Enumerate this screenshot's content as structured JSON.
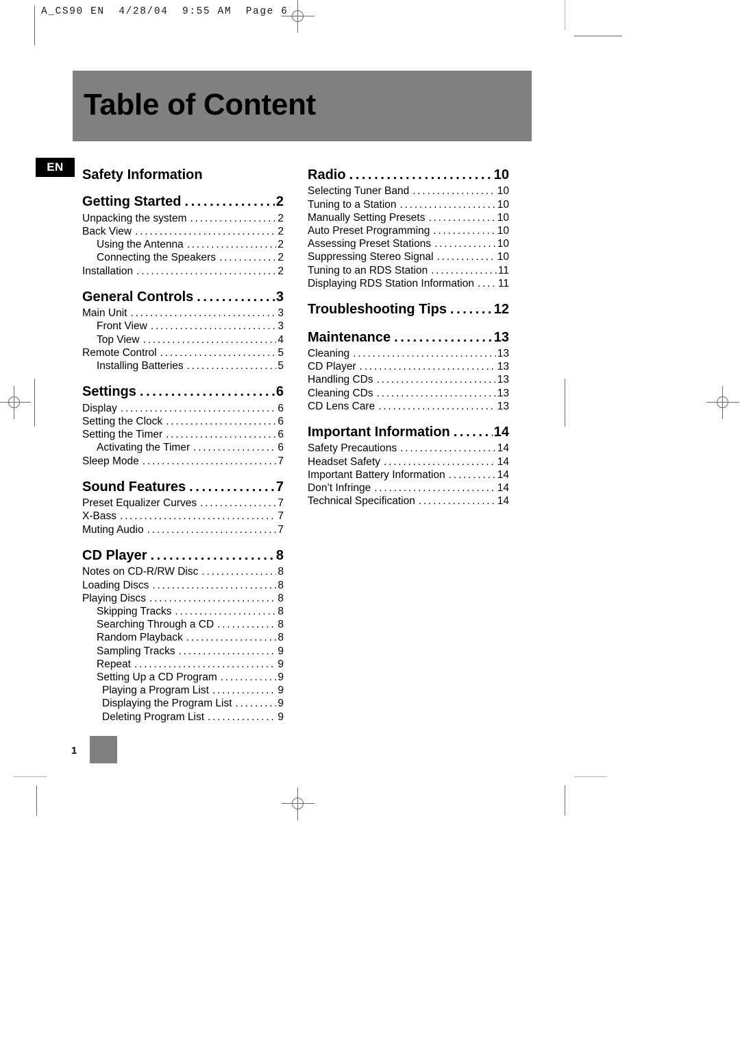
{
  "film_header": "A_CS90 EN  4/28/04  9:55 AM  Page 6",
  "banner": {
    "title": "Table of Content",
    "bg_color": "#808080"
  },
  "language_badge": {
    "label": "EN",
    "bg_color": "#000000",
    "text_color": "#ffffff"
  },
  "footer": {
    "page_number": "1",
    "swatch_color": "#808080"
  },
  "toc": {
    "left_column": [
      {
        "label": "Safety Information",
        "page": "",
        "level": "h",
        "dots": false,
        "gap": false
      },
      {
        "label": "Getting Started",
        "page": "2",
        "level": "h",
        "dots": true,
        "gap": false
      },
      {
        "label": "Unpacking the system",
        "page": "2",
        "level": "1",
        "dots": true,
        "gap": false
      },
      {
        "label": "Back View",
        "page": "2",
        "level": "1",
        "dots": true,
        "gap": false
      },
      {
        "label": "Using the Antenna",
        "page": "2",
        "level": "2",
        "dots": true,
        "gap": false
      },
      {
        "label": "Connecting the Speakers",
        "page": "2",
        "level": "2",
        "dots": true,
        "gap": false
      },
      {
        "label": "Installation",
        "page": "2",
        "level": "1",
        "dots": true,
        "gap": false
      },
      {
        "label": "General Controls",
        "page": "3",
        "level": "h",
        "dots": true,
        "gap": true
      },
      {
        "label": "Main Unit",
        "page": "3",
        "level": "1",
        "dots": true,
        "gap": false
      },
      {
        "label": "Front View",
        "page": "3",
        "level": "2",
        "dots": true,
        "gap": false
      },
      {
        "label": "Top View",
        "page": "4",
        "level": "2",
        "dots": true,
        "gap": false
      },
      {
        "label": "Remote Control",
        "page": "5",
        "level": "1",
        "dots": true,
        "gap": false
      },
      {
        "label": "Installing Batteries",
        "page": "5",
        "level": "2",
        "dots": true,
        "gap": false
      },
      {
        "label": "Settings",
        "page": "6",
        "level": "h",
        "dots": true,
        "gap": true
      },
      {
        "label": "Display",
        "page": "6",
        "level": "1",
        "dots": true,
        "gap": false
      },
      {
        "label": "Setting the Clock",
        "page": "6",
        "level": "1",
        "dots": true,
        "gap": false
      },
      {
        "label": "Setting the Timer",
        "page": "6",
        "level": "1",
        "dots": true,
        "gap": false
      },
      {
        "label": "Activating the Timer",
        "page": "6",
        "level": "2",
        "dots": true,
        "gap": false
      },
      {
        "label": "Sleep Mode",
        "page": "7",
        "level": "1",
        "dots": true,
        "gap": false
      },
      {
        "label": "Sound Features",
        "page": "7",
        "level": "h",
        "dots": true,
        "gap": true
      },
      {
        "label": "Preset Equalizer Curves",
        "page": "7",
        "level": "1",
        "dots": true,
        "gap": false
      },
      {
        "label": "X-Bass",
        "page": "7",
        "level": "1",
        "dots": true,
        "gap": false
      },
      {
        "label": "Muting Audio",
        "page": "7",
        "level": "1",
        "dots": true,
        "gap": false
      },
      {
        "label": "CD Player",
        "page": "8",
        "level": "h",
        "dots": true,
        "gap": true
      },
      {
        "label": "Notes on CD-R/RW Disc",
        "page": "8",
        "level": "1",
        "dots": true,
        "gap": false
      },
      {
        "label": "Loading Discs",
        "page": "8",
        "level": "1",
        "dots": true,
        "gap": false
      },
      {
        "label": "Playing Discs",
        "page": "8",
        "level": "1",
        "dots": true,
        "gap": false
      },
      {
        "label": "Skipping Tracks",
        "page": "8",
        "level": "2",
        "dots": true,
        "gap": false
      },
      {
        "label": "Searching Through a CD",
        "page": "8",
        "level": "2",
        "dots": true,
        "gap": false
      },
      {
        "label": "Random Playback",
        "page": "8",
        "level": "2",
        "dots": true,
        "gap": false
      },
      {
        "label": "Sampling Tracks",
        "page": "9",
        "level": "2",
        "dots": true,
        "gap": false
      },
      {
        "label": "Repeat",
        "page": "9",
        "level": "2",
        "dots": true,
        "gap": false
      },
      {
        "label": "Setting Up a CD Program",
        "page": "9",
        "level": "2",
        "dots": true,
        "gap": false
      },
      {
        "label": "Playing a Program List",
        "page": "9",
        "level": "3",
        "dots": true,
        "gap": false
      },
      {
        "label": "Displaying the Program List",
        "page": "9",
        "level": "3",
        "dots": true,
        "gap": false
      },
      {
        "label": "Deleting Program List",
        "page": "9",
        "level": "3",
        "dots": true,
        "gap": false
      }
    ],
    "right_column": [
      {
        "label": "Radio",
        "page": "10",
        "level": "h",
        "dots": true,
        "gap": false
      },
      {
        "label": "Selecting Tuner Band",
        "page": "10",
        "level": "1",
        "dots": true,
        "gap": false
      },
      {
        "label": "Tuning to a Station",
        "page": "10",
        "level": "1",
        "dots": true,
        "gap": false
      },
      {
        "label": "Manually Setting Presets",
        "page": "10",
        "level": "1",
        "dots": true,
        "gap": false
      },
      {
        "label": "Auto Preset Programming",
        "page": "10",
        "level": "1",
        "dots": true,
        "gap": false
      },
      {
        "label": "Assessing Preset Stations",
        "page": "10",
        "level": "1",
        "dots": true,
        "gap": false
      },
      {
        "label": "Suppressing Stereo Signal",
        "page": "10",
        "level": "1",
        "dots": true,
        "gap": false
      },
      {
        "label": "Tuning to an RDS Station",
        "page": "11",
        "level": "1",
        "dots": true,
        "gap": false
      },
      {
        "label": "Displaying RDS Station Information",
        "page": "11",
        "level": "1",
        "dots": true,
        "gap": false
      },
      {
        "label": "Troubleshooting Tips",
        "page": "12",
        "level": "h",
        "dots": true,
        "gap": true
      },
      {
        "label": "Maintenance",
        "page": "13",
        "level": "h",
        "dots": true,
        "gap": true
      },
      {
        "label": "Cleaning",
        "page": "13",
        "level": "1",
        "dots": true,
        "gap": false
      },
      {
        "label": "CD Player",
        "page": "13",
        "level": "1",
        "dots": true,
        "gap": false
      },
      {
        "label": "Handling CDs",
        "page": "13",
        "level": "1",
        "dots": true,
        "gap": false
      },
      {
        "label": "Cleaning CDs",
        "page": "13",
        "level": "1",
        "dots": true,
        "gap": false
      },
      {
        "label": "CD Lens Care",
        "page": "13",
        "level": "1",
        "dots": true,
        "gap": false
      },
      {
        "label": "Important Information",
        "page": "14",
        "level": "h",
        "dots": true,
        "gap": true
      },
      {
        "label": "Safety Precautions",
        "page": "14",
        "level": "1",
        "dots": true,
        "gap": false
      },
      {
        "label": "Headset Safety",
        "page": "14",
        "level": "1",
        "dots": true,
        "gap": false
      },
      {
        "label": "Important Battery Information",
        "page": "14",
        "level": "1",
        "dots": true,
        "gap": false
      },
      {
        "label": "Don’t Infringe",
        "page": "14",
        "level": "1",
        "dots": true,
        "gap": false
      },
      {
        "label": "Technical Specification",
        "page": "14",
        "level": "1",
        "dots": true,
        "gap": false
      }
    ]
  }
}
